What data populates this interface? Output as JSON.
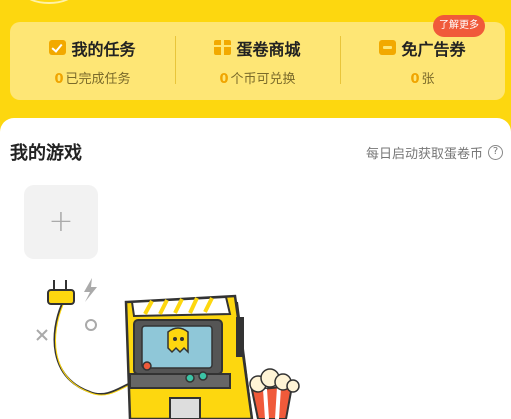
{
  "stats": [
    {
      "title": "我的任务",
      "count": "0",
      "sub": "已完成任务",
      "icon": "task-check-icon"
    },
    {
      "title": "蛋卷商城",
      "count": "0",
      "sub": "个币可兑换",
      "icon": "gift-box-icon"
    },
    {
      "title": "免广告券",
      "count": "0",
      "sub": "张",
      "icon": "ticket-icon"
    }
  ],
  "badge": "了解更多",
  "games": {
    "title": "我的游戏",
    "link": "每日启动获取蛋卷币",
    "help": "?",
    "add": "+"
  },
  "colors": {
    "header": "#FDD70F",
    "card": "#FEE675",
    "accent": "#F0A500",
    "badge": "#F05A3A"
  }
}
